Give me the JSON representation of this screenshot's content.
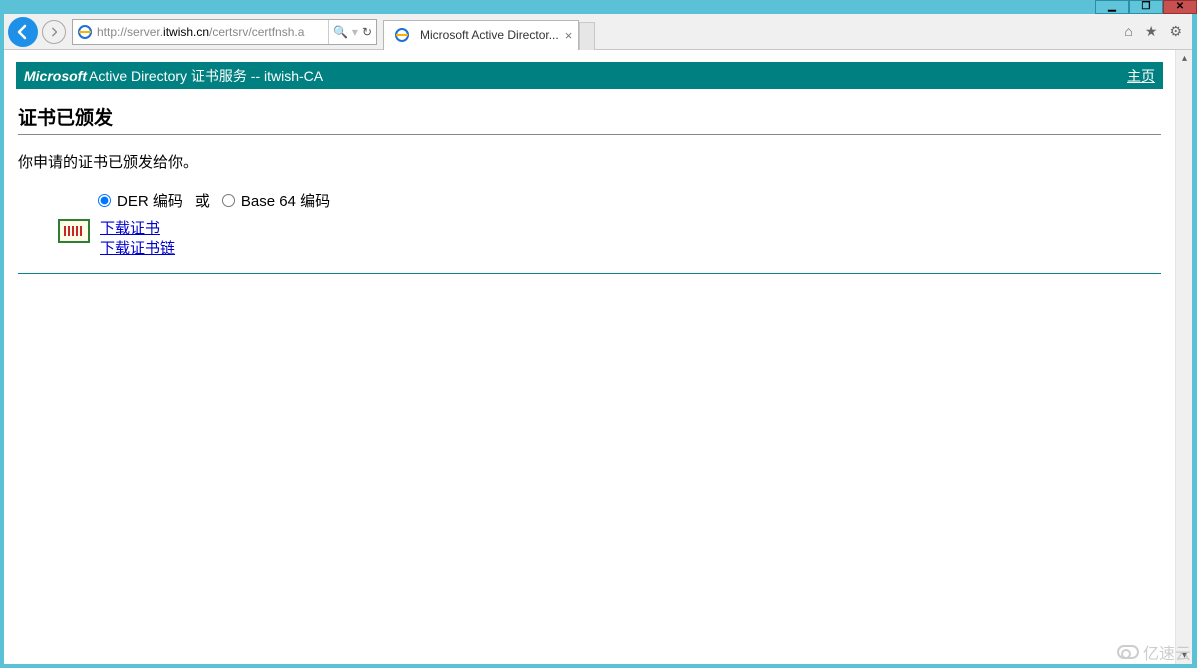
{
  "window": {
    "min_glyph": "▁",
    "max_glyph": "❐",
    "close_glyph": "✕"
  },
  "browser": {
    "url_prefix": "http://server.",
    "url_bold": "itwish.cn",
    "url_suffix": "/certsrv/certfnsh.a",
    "search_glyph": "🔍",
    "dropdown_glyph": "▾",
    "refresh_glyph": "↻",
    "tab_title": "Microsoft Active Director...",
    "tab_close": "×",
    "home_glyph": "⌂",
    "star_glyph": "★",
    "gear_glyph": "⚙"
  },
  "header": {
    "brand": "Microsoft",
    "service": " Active Directory 证书服务  --  itwish-CA",
    "home_link": "主页"
  },
  "body": {
    "title": "证书已颁发",
    "message": "你申请的证书已颁发给你。",
    "encoding": {
      "der_label": "DER 编码",
      "or_label": "或",
      "b64_label": "Base 64 编码"
    },
    "links": {
      "download_cert": "下载证书",
      "download_chain": "下载证书链"
    }
  },
  "watermark": {
    "text": "亿速云"
  }
}
